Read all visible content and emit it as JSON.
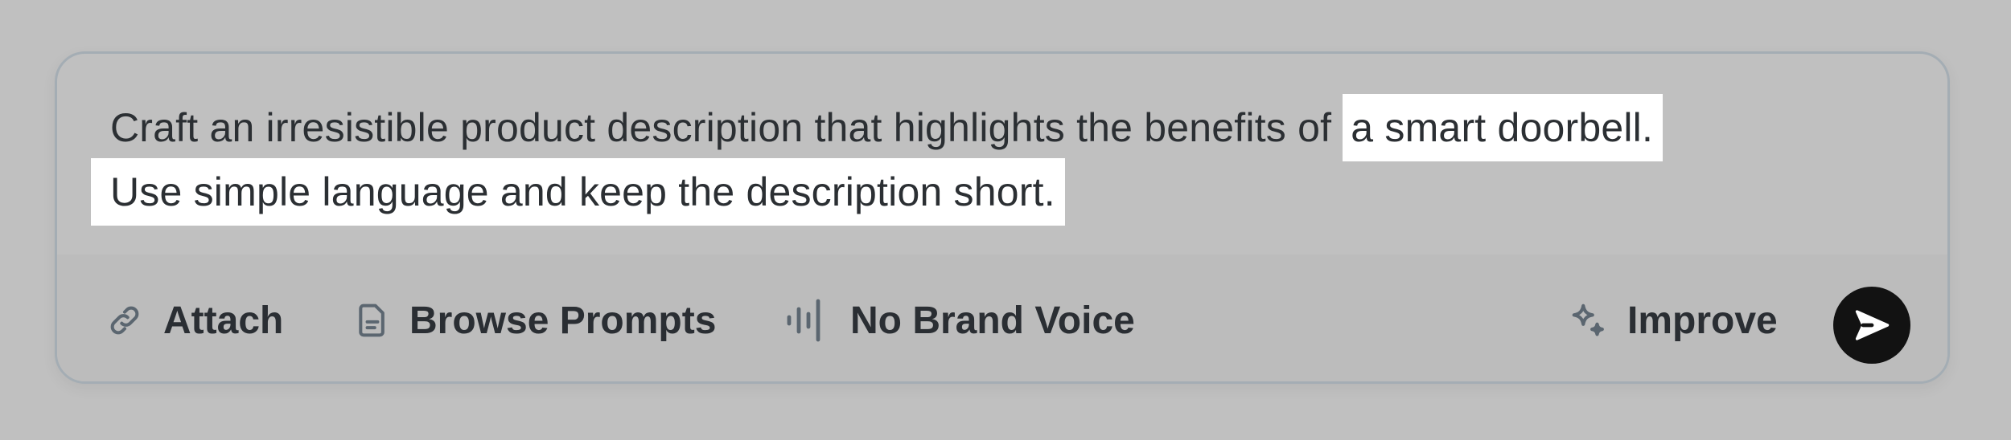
{
  "prompt": {
    "text_start": "Craft an irresistible product description that highlights the benefits of ",
    "highlight_1": "a smart doorbell.",
    "highlight_2": "Use simple language and keep the description short."
  },
  "toolbar": {
    "attach_label": "Attach",
    "attach_icon": "paperclip-icon",
    "browse_label": "Browse Prompts",
    "browse_icon": "document-icon",
    "voice_label": "No Brand Voice",
    "voice_icon": "audio-wave-icon",
    "improve_label": "Improve",
    "improve_icon": "sparkle-icon",
    "send_icon": "send-arrow-icon"
  },
  "colors": {
    "background": "#c0c0c0",
    "highlight": "#ffffff",
    "text": "#2b2f33",
    "icon": "#5b6670",
    "send_button": "#121212"
  }
}
